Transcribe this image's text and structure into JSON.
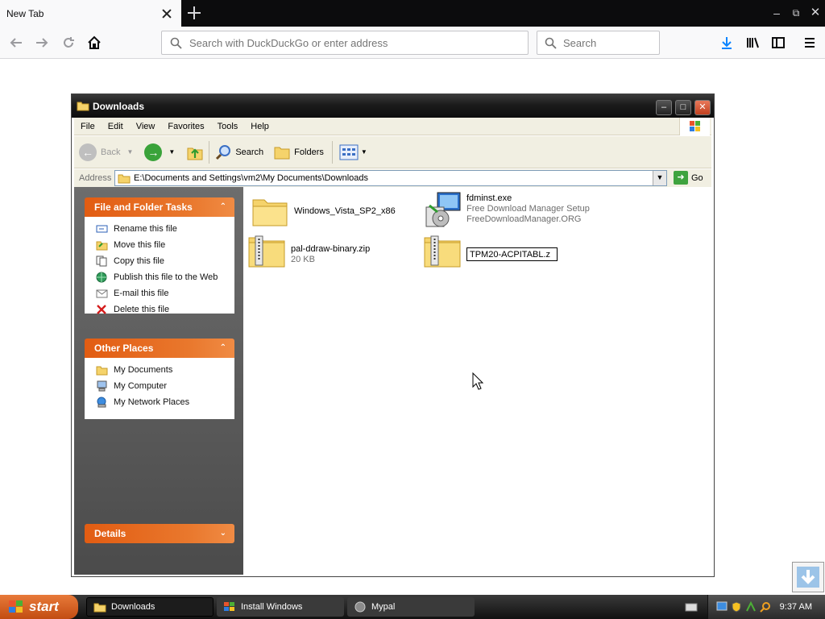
{
  "browser": {
    "tab_title": "New Tab",
    "url_placeholder": "Search with DuckDuckGo or enter address",
    "search_placeholder": "Search"
  },
  "window": {
    "title": "Downloads",
    "menu": [
      "File",
      "Edit",
      "View",
      "Favorites",
      "Tools",
      "Help"
    ],
    "toolbar": {
      "back": "Back",
      "search": "Search",
      "folders": "Folders"
    },
    "address_label": "Address",
    "address_value": "E:\\Documents and Settings\\vm2\\My Documents\\Downloads",
    "go_label": "Go"
  },
  "tasks_panel": {
    "title": "File and Folder Tasks",
    "items": [
      {
        "label": "Rename this file",
        "icon": "rename-icon"
      },
      {
        "label": "Move this file",
        "icon": "move-icon"
      },
      {
        "label": "Copy this file",
        "icon": "copy-icon"
      },
      {
        "label": "Publish this file to the Web",
        "icon": "globe-icon"
      },
      {
        "label": "E-mail this file",
        "icon": "email-icon"
      },
      {
        "label": "Delete this file",
        "icon": "delete-icon"
      }
    ]
  },
  "places_panel": {
    "title": "Other Places",
    "items": [
      {
        "label": "My Documents",
        "icon": "folder-icon"
      },
      {
        "label": "My Computer",
        "icon": "computer-icon"
      },
      {
        "label": "My Network Places",
        "icon": "network-icon"
      }
    ]
  },
  "details_panel": {
    "title": "Details"
  },
  "files": [
    {
      "name": "Windows_Vista_SP2_x86",
      "sub1": "",
      "sub2": "",
      "icon": "folder-icon"
    },
    {
      "name": "fdminst.exe",
      "sub1": "Free Download Manager Setup",
      "sub2": "FreeDownloadManager.ORG",
      "icon": "installer-icon"
    },
    {
      "name": "pal-ddraw-binary.zip",
      "sub1": "20 KB",
      "sub2": "",
      "icon": "zip-folder-icon"
    },
    {
      "name": "TPM20-ACPITABL.z",
      "sub1": "",
      "sub2": "",
      "icon": "zip-folder-icon"
    }
  ],
  "taskbar": {
    "start_label": "start",
    "tasks": [
      "Downloads",
      "Install Windows",
      "Mypal"
    ],
    "clock": "9:37 AM"
  }
}
